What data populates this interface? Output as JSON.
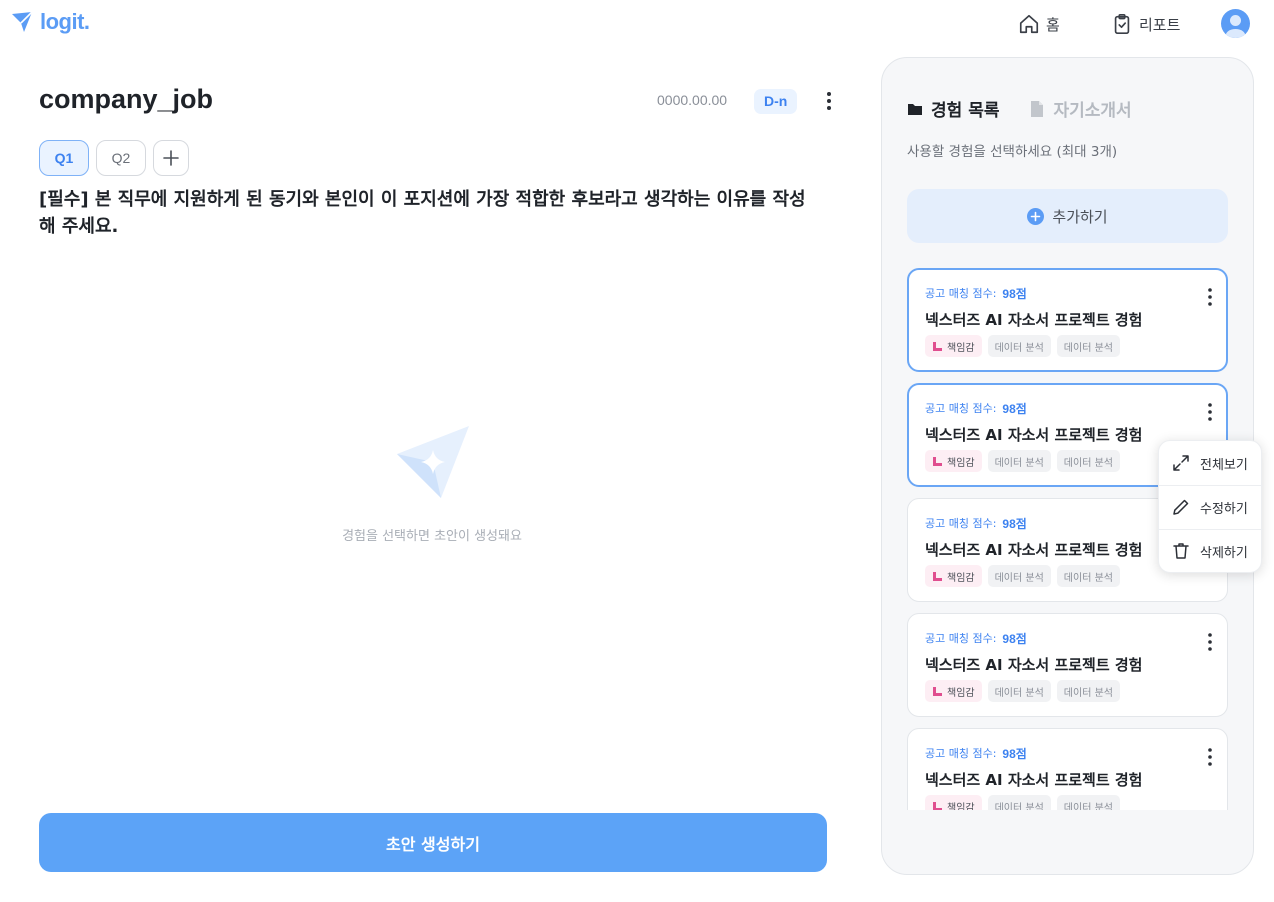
{
  "app": {
    "logo_text": "logit."
  },
  "nav": {
    "home_label": "홈",
    "report_label": "리포트"
  },
  "doc": {
    "title": "company_job",
    "date": "0000.00.00",
    "dday": "D-n",
    "tabs": [
      {
        "label": "Q1",
        "active": true
      },
      {
        "label": "Q2",
        "active": false
      }
    ],
    "question": "[필수] 본 직무에 지원하게 된 동기와 본인이 이 포지션에 가장 적합한 후보라고 생각하는 이유를 작성해 주세요.",
    "empty_text": "경험을 선택하면 초안이 생성돼요",
    "generate_label": "초안 생성하기"
  },
  "panel": {
    "tab_experience": "경험 목록",
    "tab_coverletter": "자기소개서",
    "hint": "사용할 경험을 선택하세요 (최대 3개)",
    "add_label": "추가하기",
    "score_prefix": "공고 매칭 점수:",
    "cards": [
      {
        "score": "98점",
        "title": "넥스터즈 AI 자소서 프로젝트 경험",
        "tags": [
          "책임감",
          "데이터 분석",
          "데이터 분석"
        ],
        "selected": true
      },
      {
        "score": "98점",
        "title": "넥스터즈 AI 자소서 프로젝트 경험",
        "tags": [
          "책임감",
          "데이터 분석",
          "데이터 분석"
        ],
        "selected": true
      },
      {
        "score": "98점",
        "title": "넥스터즈 AI 자소서 프로젝트 경험",
        "tags": [
          "책임감",
          "데이터 분석",
          "데이터 분석"
        ],
        "selected": false
      },
      {
        "score": "98점",
        "title": "넥스터즈 AI 자소서 프로젝트 경험",
        "tags": [
          "책임감",
          "데이터 분석",
          "데이터 분석"
        ],
        "selected": false
      },
      {
        "score": "98점",
        "title": "넥스터즈 AI 자소서 프로젝트 경험",
        "tags": [
          "책임감",
          "데이터 분석",
          "데이터 분석"
        ],
        "selected": false
      }
    ]
  },
  "context_menu": {
    "items": [
      {
        "label": "전체보기",
        "icon": "expand-icon"
      },
      {
        "label": "수정하기",
        "icon": "pencil-icon"
      },
      {
        "label": "삭제하기",
        "icon": "trash-icon"
      }
    ]
  },
  "colors": {
    "primary": "#5ca3f7",
    "accent": "#3d82f0",
    "selected_border": "#6aa6f5",
    "tag_pink": "#e04e8f"
  }
}
